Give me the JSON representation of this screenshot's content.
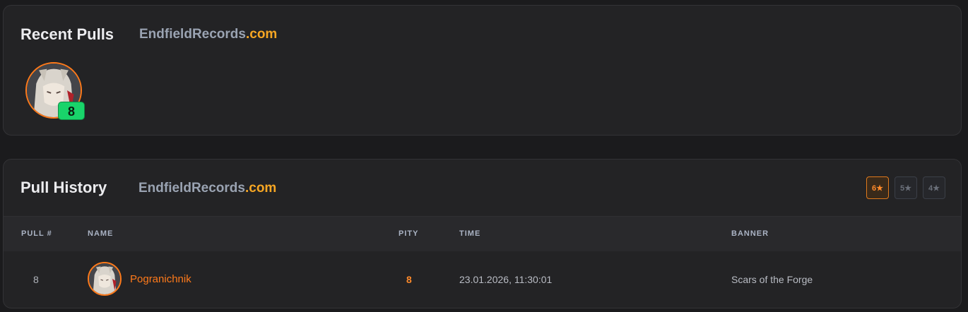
{
  "recent": {
    "title": "Recent Pulls",
    "brand_name": "EndfieldRecords",
    "brand_tld": ".com",
    "pulls": [
      {
        "pity": "8"
      }
    ]
  },
  "history": {
    "title": "Pull History",
    "brand_name": "EndfieldRecords",
    "brand_tld": ".com",
    "filters": [
      "6★",
      "5★",
      "4★"
    ],
    "active_filter": "6★",
    "columns": {
      "pull": "PULL #",
      "name": "NAME",
      "pity": "PITY",
      "time": "TIME",
      "banner": "BANNER"
    },
    "rows": [
      {
        "pull": "8",
        "name": "Pogranichnik",
        "pity": "8",
        "time": "23.01.2026, 11:30:01",
        "banner": "Scars of the Forge"
      }
    ]
  },
  "colors": {
    "accent": "#ff7a1a",
    "brand_tld": "#f6a623",
    "pity_badge": "#19d46a"
  }
}
